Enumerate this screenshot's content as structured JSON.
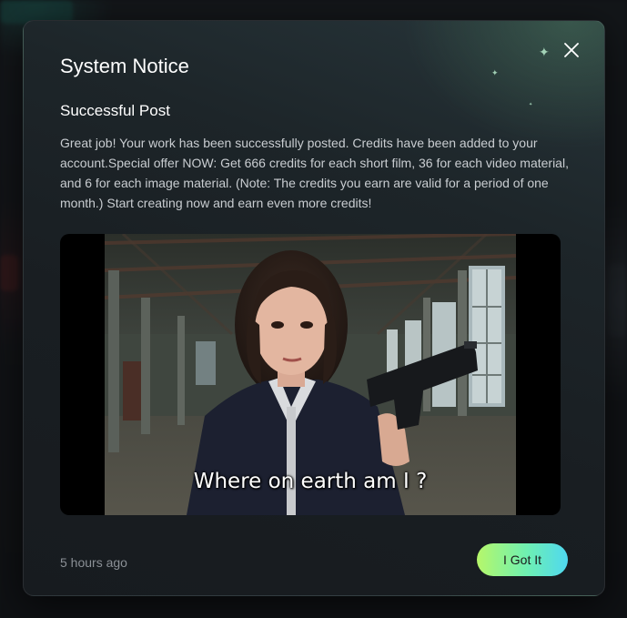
{
  "dialog": {
    "title": "System Notice",
    "post_title": "Successful Post",
    "message": "Great job! Your work has been successfully posted. Credits have been added to your account.Special offer NOW: Get 666 credits for each short film, 36 for each video material, and 6 for each image material. (Note: The credits you earn are valid for a period of one month.) Start creating now and earn even more credits!",
    "media": {
      "caption": "Where on earth am I ?",
      "subject": "woman-holding-pistol-in-abandoned-building"
    },
    "timestamp": "5 hours ago",
    "confirm_label": "I Got It",
    "close_icon": "close-icon"
  },
  "colors": {
    "modal_bg": "#1b2226",
    "button_gradient_start": "#b6f76a",
    "button_gradient_mid": "#6ef0b2",
    "button_gradient_end": "#4fd8f0",
    "text_primary": "#ffffff",
    "text_secondary": "#c9cdd1",
    "text_muted": "#8b9096"
  }
}
